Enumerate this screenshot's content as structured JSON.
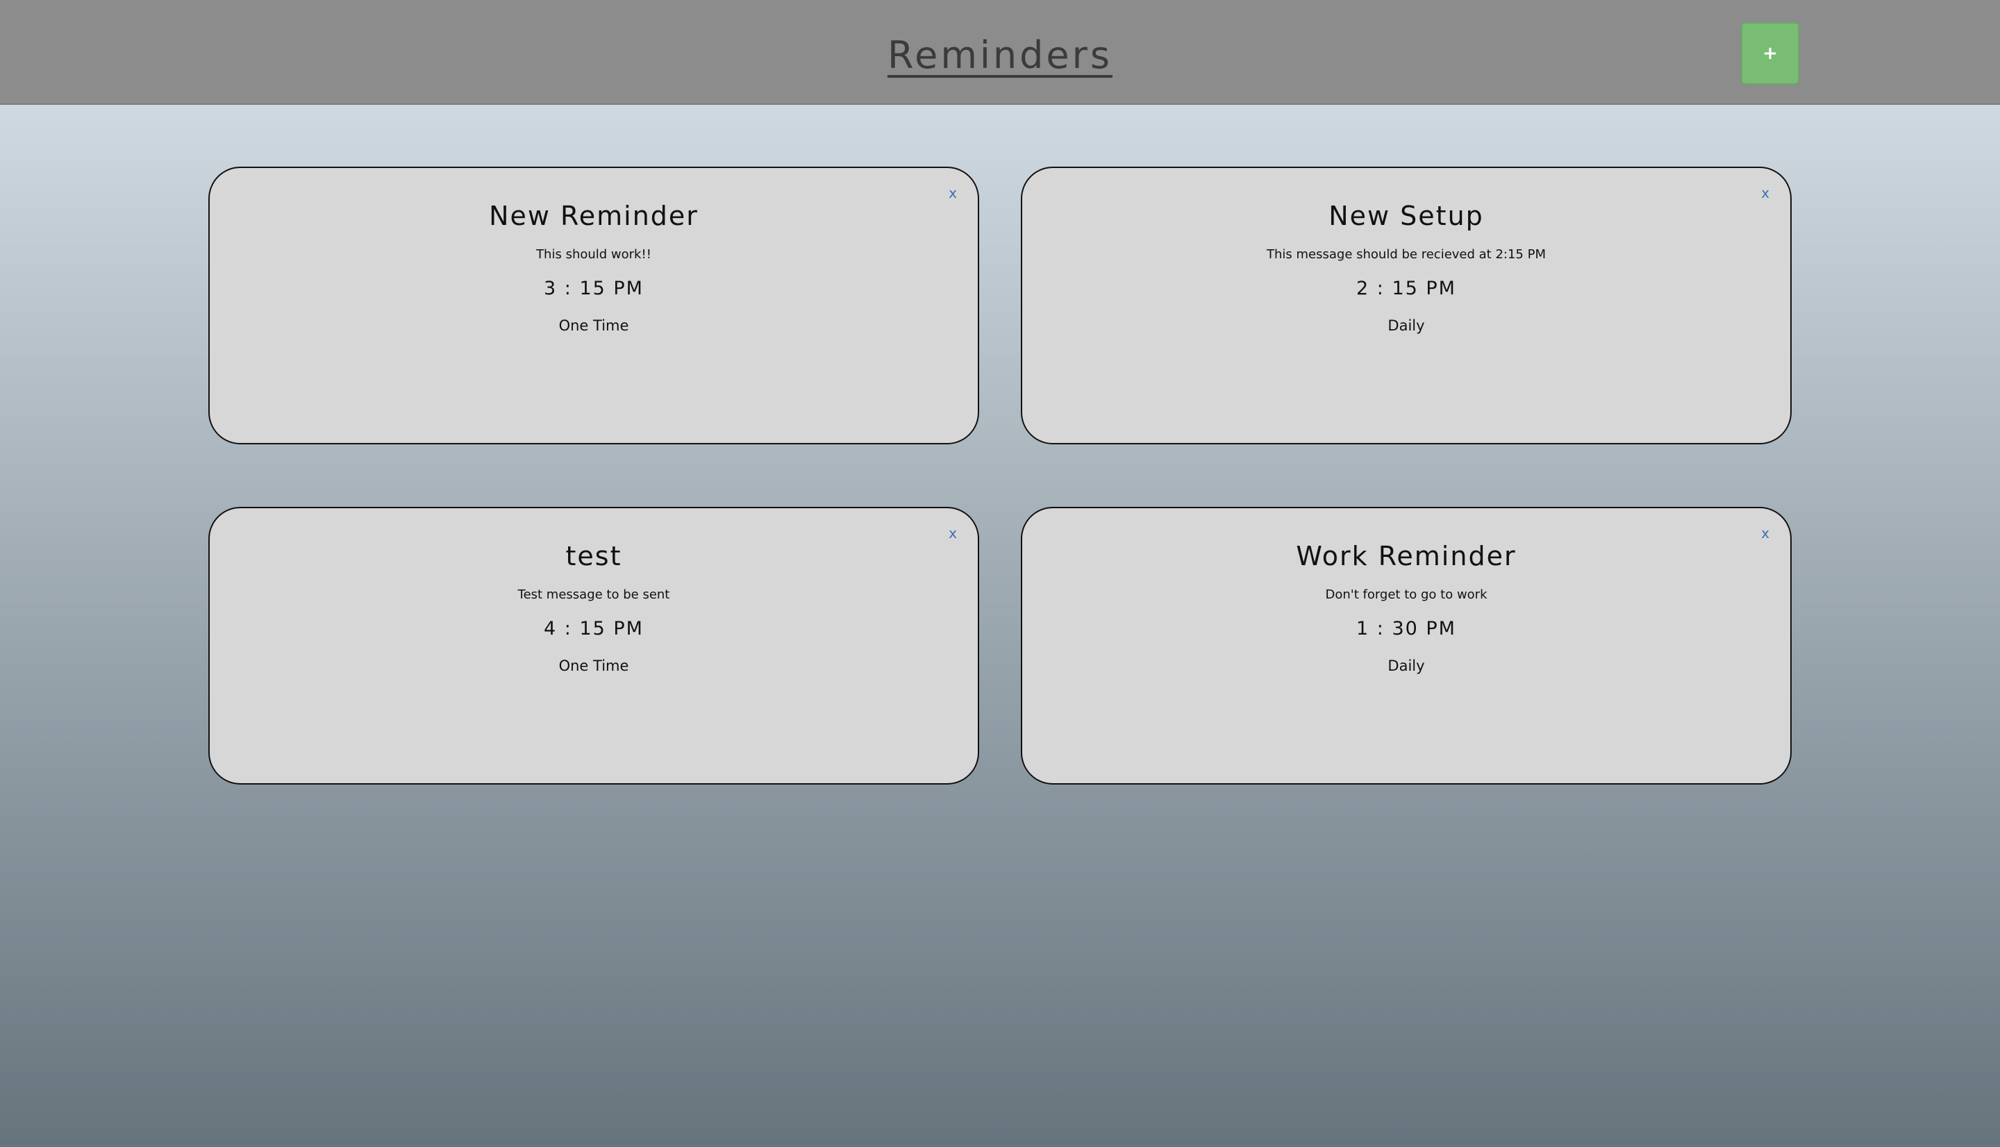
{
  "header": {
    "title": "Reminders",
    "add_label": "+"
  },
  "reminders": [
    {
      "title": "New Reminder",
      "message": "This should work!!",
      "time": "3 : 15 PM",
      "frequency": "One Time",
      "close_label": "x"
    },
    {
      "title": "New Setup",
      "message": "This message should be recieved at 2:15 PM",
      "time": "2 : 15 PM",
      "frequency": "Daily",
      "close_label": "x"
    },
    {
      "title": "test",
      "message": "Test message to be sent",
      "time": "4 : 15 PM",
      "frequency": "One Time",
      "close_label": "x"
    },
    {
      "title": "Work Reminder",
      "message": "Don't forget to go to work",
      "time": "1 : 30 PM",
      "frequency": "Daily",
      "close_label": "x"
    }
  ]
}
